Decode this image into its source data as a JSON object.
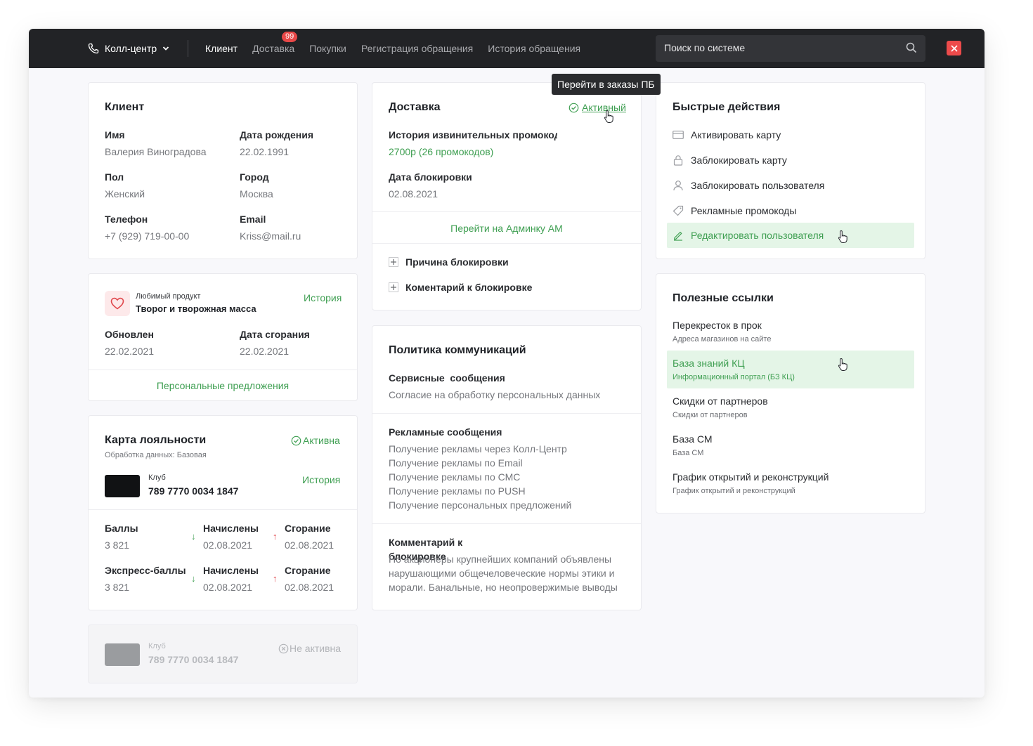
{
  "topbar": {
    "callcenter_label": "Колл-центр",
    "nav": [
      "Клиент",
      "Доставка",
      "Покупки",
      "Регистрация обращения",
      "История обращения"
    ],
    "delivery_badge": "99",
    "search_placeholder": "Поиск по системе"
  },
  "tooltip": "Перейти в заказы ПБ",
  "client": {
    "title": "Клиент",
    "name_label": "Имя",
    "name": "Валерия Виноградова",
    "birth_label": "Дата рождения",
    "birth": "22.02.1991",
    "gender_label": "Пол",
    "gender": "Женский",
    "city_label": "Город",
    "city": "Москва",
    "phone_label": "Телефон",
    "phone": "+7 (929) 719-00-00",
    "email_label": "Email",
    "email": "Kriss@mail.ru"
  },
  "favorite": {
    "caption": "Любимый продукт",
    "product": "Творог и творожная масса",
    "history_link": "История",
    "updated_label": "Обновлен",
    "updated": "22.02.2021",
    "expire_label": "Дата сгорания",
    "expire": "22.02.2021",
    "offers_link": "Персональные предложения"
  },
  "loyalty": {
    "title": "Карта лояльности",
    "status": "Активна",
    "processing": "Обработка данных: Базовая",
    "club_label": "Клуб",
    "card_number": "789 7770 0034 1847",
    "history_link": "История",
    "points_label": "Баллы",
    "points": "3 821",
    "accrued_label": "Начислены",
    "accrued_date": "02.08.2021",
    "burn_label": "Сгорание",
    "burn_date": "02.08.2021",
    "express_label": "Экспресс-баллы",
    "express": "3 821",
    "accrued2_label": "Начислены",
    "accrued2_date": "02.08.2021",
    "burn2_label": "Сгорание",
    "burn2_date": "02.08.2021"
  },
  "inactive_card": {
    "club_label": "Клуб",
    "card_number": "789 7770 0034 1847",
    "status": "Не активна"
  },
  "delivery": {
    "title": "Доставка",
    "status_link": "Активный",
    "promo_label": "История извинительных промокодо",
    "promo_value": "2700р (26 промокодов)",
    "block_date_label": "Дата блокировки",
    "block_date": "02.08.2021",
    "admin_link": "Перейти на Админку АМ",
    "reason": "Причина блокировки",
    "comment": "Коментарий к блокировке"
  },
  "policy": {
    "title": "Политика коммуникаций",
    "service_label": "Сервисные  сообщения",
    "service_value": "Согласие на обработку персональных данных",
    "ads_label": "Рекламные сообщения",
    "ads_items": [
      "Получение рекламы через Колл-Центр",
      "Получение рекламы по Email",
      "Получение рекламы по СМС",
      "Получение рекламы по PUSH",
      "Получение персональных предложений"
    ],
    "comment_label_line1": "Комментарий к",
    "comment_label_line2": "блокировке",
    "comment_text_lines": [
      "Но акционеры крупнейших компаний объявлены",
      "нарушающими общечеловеческие нормы этики и",
      "морали. Банальные, но неопровержимые выводы"
    ]
  },
  "quick_actions": {
    "title": "Быстрые действия",
    "items": [
      {
        "label": "Активировать карту",
        "icon": "card-icon"
      },
      {
        "label": "Заблокировать карту",
        "icon": "lock-icon"
      },
      {
        "label": "Заблокировать пользователя",
        "icon": "user-icon"
      },
      {
        "label": "Рекламные промокоды",
        "icon": "tag-icon"
      },
      {
        "label": "Редактировать пользователя",
        "icon": "pencil-icon"
      }
    ]
  },
  "links": {
    "title": "Полезные ссылки",
    "items": [
      {
        "title": "Перекресток в прок",
        "sub": "Адреса магазинов на сайте"
      },
      {
        "title": "База знаний КЦ",
        "sub": "Информационный портал (БЗ КЦ)"
      },
      {
        "title": "Скидки от партнеров",
        "sub": "Скидки от партнеров"
      },
      {
        "title": "База СМ",
        "sub": "База СМ"
      },
      {
        "title": "График открытий и реконструкций",
        "sub": "График открытий и реконструкций"
      }
    ]
  },
  "colors": {
    "accent_green": "#3f9f52",
    "highlight_green": "#e4f5e7",
    "topbar": "#222326",
    "danger": "#ed4b4b"
  }
}
